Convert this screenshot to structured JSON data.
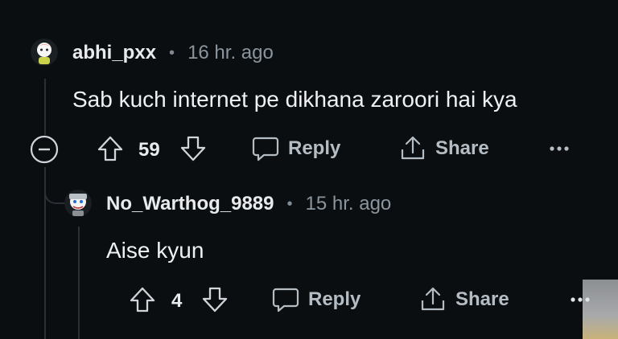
{
  "comments": [
    {
      "username": "abhi_pxx",
      "separator": "•",
      "time": "16 hr. ago",
      "text": "Sab kuch internet pe dikhana zaroori hai kya",
      "votes": "59",
      "reply_label": "Reply",
      "share_label": "Share"
    },
    {
      "username": "No_Warthog_9889",
      "separator": "•",
      "time": "15 hr. ago",
      "text": "Aise kyun",
      "votes": "4",
      "reply_label": "Reply",
      "share_label": "Share"
    }
  ],
  "icons": {
    "collapse": "collapse-icon",
    "upvote": "upvote-icon",
    "downvote": "downvote-icon",
    "reply": "reply-icon",
    "share": "share-icon",
    "more": "more-icon"
  }
}
